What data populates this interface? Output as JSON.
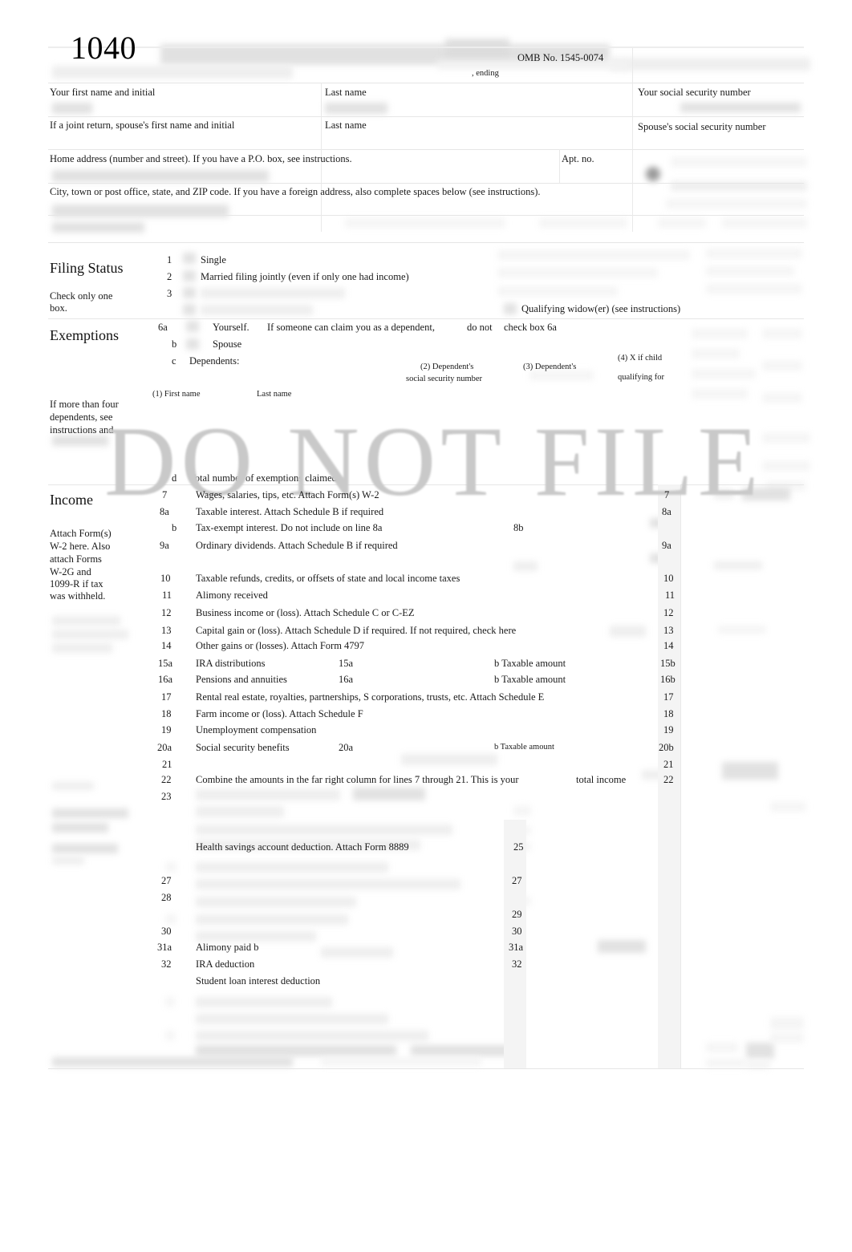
{
  "form": {
    "number": "1040",
    "omb": "OMB No. 1545-0074",
    "ending": ", ending",
    "watermark": "DO NOT FILE"
  },
  "identity": {
    "your_first_name_label": "Your first name and initial",
    "last_name_label": "Last name",
    "spouse_first_name_label": "If a joint return, spouse's first name and initial",
    "spouse_last_name_label": "Last name",
    "your_ssn_label": "Your social security number",
    "spouse_ssn_label": "Spouse's social security number",
    "home_address_label": "Home address (number and street). If you have a P.O. box, see instructions.",
    "apt_label": "Apt. no.",
    "city_label": "City, town or post office, state, and ZIP code. If you have a foreign address, also complete spaces below (see instructions)."
  },
  "filing_status": {
    "title": "Filing Status",
    "note_line1": "Check only one",
    "note_line2": "box.",
    "options": [
      {
        "num": "1",
        "label": "Single"
      },
      {
        "num": "2",
        "label": "Married filing jointly (even if only one had income)"
      },
      {
        "num": "3",
        "label": ""
      }
    ],
    "qualifying_widow": "Qualifying widow(er) (see instructions)"
  },
  "exemptions": {
    "title": "Exemptions",
    "line_6a_num": "6a",
    "line_6a_yourself": "Yourself.",
    "line_6a_text": "If someone can claim you as a dependent,",
    "line_6a_donot": "do not",
    "line_6a_checkbox": "check box 6a",
    "line_b_num": "b",
    "line_b_label": "Spouse",
    "line_c_num": "c",
    "line_c_label": "Dependents:",
    "col2_line1": "(2)  Dependent's",
    "col2_line2": "social security number",
    "col3": "(3)  Dependent's",
    "col4_line1": "(4)   X if child",
    "col4_line2": "qualifying for",
    "col1_first": "(1) First name",
    "col1_last": "Last name",
    "side_note_1": "If more than four",
    "side_note_2": "dependents, see",
    "side_note_3": "instructions and",
    "line_d_num": "d",
    "line_d_label": "Total number of exemptions claimed"
  },
  "income": {
    "title": "Income",
    "side_note": [
      "Attach Form(s)",
      "W-2 here. Also",
      "attach Forms",
      "W-2G and",
      "1099-R if tax",
      "was withheld."
    ],
    "lines": [
      {
        "num": "7",
        "text": "Wages, salaries, tips, etc. Attach Form(s) W-2",
        "right": "7"
      },
      {
        "num": "8a",
        "text": "Taxable    interest. Attach Schedule B if required",
        "right": "8a"
      },
      {
        "num": "b",
        "text": "Tax-exempt    interest.   Do not   include on line 8a",
        "mid": "8b",
        "right": ""
      },
      {
        "num": "9a",
        "text": "Ordinary dividends. Attach Schedule B if required",
        "right": "9a"
      },
      {
        "num": "10",
        "text": "Taxable refunds, credits, or offsets of state and local income taxes",
        "right": "10"
      },
      {
        "num": "11",
        "text": "Alimony received",
        "right": "11"
      },
      {
        "num": "12",
        "text": "Business income or (loss). Attach Schedule C or C-EZ",
        "right": "12"
      },
      {
        "num": "13",
        "text": "Capital gain or (loss). Attach Schedule D if required. If not required, check here",
        "right": "13"
      },
      {
        "num": "14",
        "text": "Other gains or (losses). Attach Form 4797",
        "right": "14"
      },
      {
        "num": "15a",
        "text": "IRA distributions",
        "mid": "15a",
        "taxable": "b  Taxable amount",
        "right": "15b"
      },
      {
        "num": "16a",
        "text": "Pensions and annuities",
        "mid": "16a",
        "taxable": "b  Taxable amount",
        "right": "16b"
      },
      {
        "num": "17",
        "text": "Rental real estate, royalties, partnerships, S corporations, trusts, etc. Attach Schedule E",
        "right": "17"
      },
      {
        "num": "18",
        "text": "Farm income or (loss). Attach Schedule F",
        "right": "18"
      },
      {
        "num": "19",
        "text": "Unemployment compensation",
        "right": "19"
      },
      {
        "num": "20a",
        "text": "Social security benefits",
        "mid": "20a",
        "taxable": "b  Taxable amount",
        "right": "20b"
      },
      {
        "num": "21",
        "text": "",
        "right": "21"
      },
      {
        "num": "22",
        "text": "Combine the amounts in the far right column for lines 7 through 21. This is your",
        "emphasis": "total income",
        "right": "22"
      },
      {
        "num": "23",
        "text": "",
        "right": ""
      }
    ]
  },
  "adjusted_gross_income": {
    "lines": [
      {
        "num": "",
        "text": "Health savings account deduction. Attach Form 8889",
        "mid": "25",
        "right": ""
      },
      {
        "num": "27",
        "text": "",
        "mid": "27",
        "right": ""
      },
      {
        "num": "28",
        "text": "",
        "mid": "",
        "right": ""
      },
      {
        "num": "",
        "text": "",
        "mid": "29",
        "right": ""
      },
      {
        "num": "30",
        "text": "",
        "mid": "30",
        "right": ""
      },
      {
        "num": "31a",
        "text": "Alimony paid     b",
        "mid": "31a",
        "right": ""
      },
      {
        "num": "32",
        "text": "IRA deduction",
        "mid": "32",
        "right": ""
      },
      {
        "num": "",
        "text": "Student loan interest deduction",
        "mid": "",
        "right": ""
      }
    ]
  }
}
